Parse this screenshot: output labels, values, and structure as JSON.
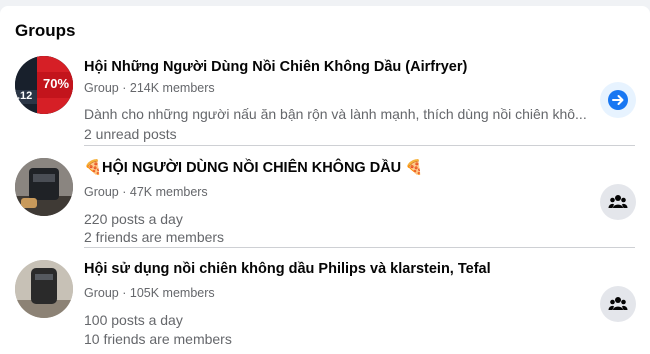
{
  "section": {
    "title": "Groups"
  },
  "groups": [
    {
      "name": "Hội Những Người Dùng Nồi Chiên Không Dầu (Airfryer)",
      "type": "Group",
      "members": "214K members",
      "line1": "Dành cho những người nấu ăn bận rộn và lành mạnh, thích dùng nồi chiên khô...",
      "line2": "2 unread posts",
      "avatar_badge": "70%",
      "avatar_small": ".12",
      "action_icon": "arrow-right-icon"
    },
    {
      "name": "🍕HỘI NGƯỜI DÙNG NỒI CHIÊN KHÔNG DẦU 🍕",
      "type": "Group",
      "members": "47K members",
      "line1": "220 posts a day",
      "line2": "2 friends are members",
      "action_icon": "join-group-icon"
    },
    {
      "name": "Hội sử dụng nồi chiên không dầu Philips và klarstein, Tefal",
      "type": "Group",
      "members": "105K members",
      "line1": "100 posts a day",
      "line2": "10 friends are members",
      "action_icon": "join-group-icon"
    }
  ],
  "colors": {
    "accent": "#1877f2",
    "secondary_text": "#65676b"
  }
}
